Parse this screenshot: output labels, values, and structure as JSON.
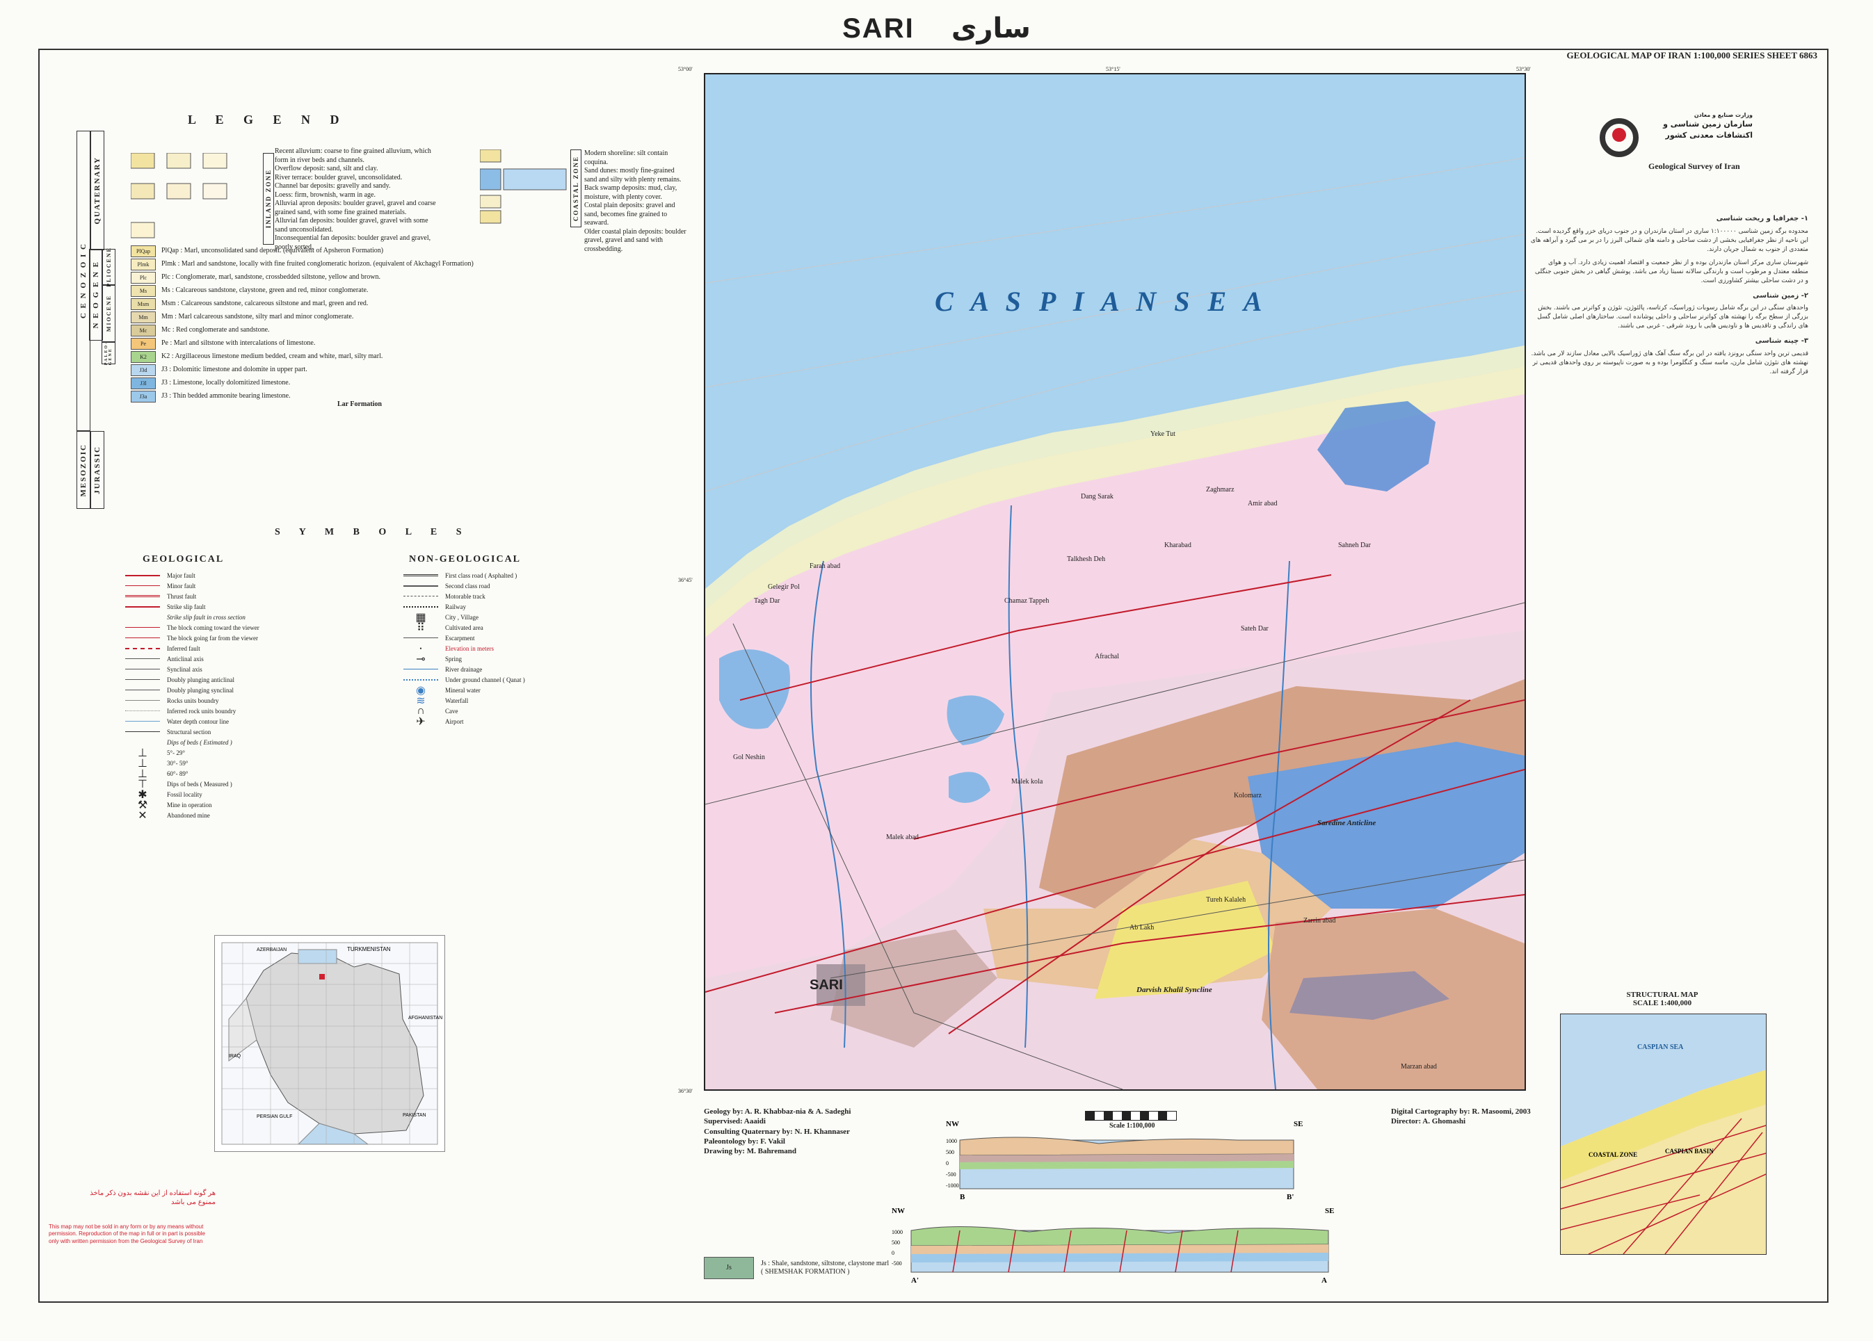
{
  "title": {
    "en": "SARI",
    "fa": "ساری"
  },
  "series_note": "GEOLOGICAL MAP OF IRAN 1:100,000 SERIES SHEET 6863",
  "legend": {
    "heading": "L E G E N D",
    "era_labels": [
      "C E N O Z O I C",
      "MESOZOIC"
    ],
    "period_labels": [
      "QUATERNARY",
      "N E O G E N E",
      "JURASSIC"
    ],
    "epoch_labels": [
      "PLIOCENE",
      "MIOCENE",
      "PALEO-GENE",
      "LATE",
      "LATE"
    ],
    "zone_labels": [
      "INLAND ZONE",
      "COASTAL ZONE"
    ],
    "quaternary_inland": [
      "Recent alluvium: coarse to fine grained alluvium, which form in river beds and channels.",
      "Overflow deposit: sand, silt and clay.",
      "River terrace: boulder gravel, unconsolidated.",
      "Channel bar deposits: gravelly and sandy.",
      "Loess: firm, brownish, warm in age.",
      "Alluvial apron deposits: boulder gravel, gravel and coarse grained sand, with some fine grained materials.",
      "Alluvial fan deposits: boulder gravel, gravel with some sand unconsolidated.",
      "Inconsequential fan deposits: boulder gravel and gravel, poorly sorted."
    ],
    "quaternary_coastal": [
      "Modern shoreline: silt contain coquina.",
      "Sand dunes: mostly fine-grained sand and silty with plenty remains.",
      "Back swamp deposits: mud, clay, moisture, with plenty cover.",
      "Costal plain deposits: gravel and sand, becomes fine grained to seaward.",
      "Older coastal plain deposits: boulder gravel, gravel and sand with crossbedding."
    ],
    "units": [
      {
        "code": "PlQap",
        "color": "#f2e3a0",
        "text": "PlQap : Marl, unconsolidated sand deposit. (equivalent of Apsheron Formation)"
      },
      {
        "code": "Plmk",
        "color": "#f6ecc0",
        "text": "Plmk : Marl and sandstone, locally with fine fruited conglomeratic horizon. (equivalent of Akchagyl Formation)"
      },
      {
        "code": "Plc",
        "color": "#f9f2d4",
        "text": "Plc : Conglomerate, marl, sandstone, crossbedded siltstone, yellow and brown."
      },
      {
        "code": "Ms",
        "color": "#efe4b0",
        "text": "Ms : Calcareous sandstone, claystone, green and red, minor conglomerate."
      },
      {
        "code": "Msm",
        "color": "#e9dea8",
        "text": "Msm : Calcareous sandstone, calcareous siltstone and marl, green and red."
      },
      {
        "code": "Mm",
        "color": "#e6d9b0",
        "text": "Mm : Marl calcareous sandstone, silty marl and minor conglomerate."
      },
      {
        "code": "Mc",
        "color": "#d9cb9a",
        "text": "Mc : Red conglomerate and sandstone."
      },
      {
        "code": "Pe",
        "color": "#f3c67a",
        "text": "Pe : Marl and siltstone with intercalations of limestone."
      },
      {
        "code": "K2",
        "color": "#a9d48e",
        "text": "K2 : Argillaceous limestone medium bedded, cream and white, marl, silty marl."
      },
      {
        "code": "J3d",
        "color": "#b8d7ef",
        "text": "J3 : Dolomitic limestone and dolomite in upper part."
      },
      {
        "code": "J3l",
        "color": "#7fb6e0",
        "text": "J3 : Limestone, locally dolomitized limestone."
      },
      {
        "code": "J3a",
        "color": "#9cc8ea",
        "text": "J3 : Thin bedded ammonite bearing limestone."
      }
    ],
    "lar_formation": "Lar Formation"
  },
  "symbols": {
    "heading": "S Y M B O L E S",
    "geological_heading": "GEOLOGICAL",
    "non_geological_heading": "NON-GEOLOGICAL",
    "geological": [
      "Major fault",
      "Minor fault",
      "Thrust fault",
      "Strike slip fault",
      "Strike slip fault in cross section",
      "The block coming toward the viewer",
      "The block going far from the viewer",
      "Inferred fault",
      "Anticlinal axis",
      "Synclinal axis",
      "Doubly plunging anticlinal",
      "Doubly plunging synclinal",
      "Rocks units boundry",
      "Inferred rock units boundry",
      "Water depth contour line",
      "Structural section",
      "Dips of beds ( Estimated )",
      "5°- 29°",
      "30°- 59°",
      "60°- 89°",
      "Dips of beds ( Measured )",
      "Fossil locality",
      "Mine in operation",
      "Abandoned mine"
    ],
    "non_geological": [
      "First class road ( Asphalted )",
      "Second class road",
      "Motorable track",
      "Railway",
      "City , Village",
      "Cultivated area",
      "Escarpment",
      "Elevation in meters",
      "Spring",
      "River drainage",
      "Under ground channel ( Qanat )",
      "Mineral water",
      "Waterfall",
      "Cave",
      "Airport"
    ]
  },
  "map": {
    "sea_label": "C A S P I A N   S E A",
    "corner_coords": [
      "53°00'",
      "53°15'",
      "53°30'",
      "36°45'",
      "36°30'"
    ],
    "places": [
      "SARI",
      "Yeke Tut",
      "Zaghmarz",
      "Farah abad",
      "Tagh Dar",
      "Gelegir Pol",
      "Amir abad",
      "Dang Sarak",
      "Kharabad",
      "Chamaz Tappeh",
      "Talkhesh Deh",
      "Sateh Dar",
      "Afrachal",
      "Sahneh Dar",
      "Gol Neshin",
      "Malek abad",
      "Malek kola",
      "Darvish Khalil Syncline",
      "Zarrin abad",
      "Ab Lakh",
      "Saredine Anticline",
      "Kolomarz",
      "Tureh Kalaleh",
      "Marzan abad"
    ],
    "scale": "Scale 1:100,000",
    "credits_left": [
      "Geology by: A. R. Khabbaz-nia & A. Sadeghi",
      "Supervised: Aaaidi",
      "Consulting Quaternary by: N. H. Khannaser",
      "Paleontology by: F. Vakil",
      "Drawing by: M. Bahremand"
    ],
    "credits_right": [
      "Digital Cartography by: R. Masoomi, 2003",
      "Director: A. Ghomashi"
    ]
  },
  "agency": {
    "fa_lines": [
      "وزارت صنایع و معادن",
      "سازمان زمین شناسی و",
      "اکتشافات معدنی کشور"
    ],
    "en_line": "Geological Survey of Iran"
  },
  "structural_map": {
    "title": "STRUCTURAL MAP",
    "scale": "SCALE 1:400,000",
    "labels": [
      "CASPIAN SEA",
      "COASTAL ZONE",
      "CASPIAN BASIN"
    ]
  },
  "sections": {
    "top": {
      "left": "NW",
      "right": "SE",
      "label_left": "B",
      "label_right": "B'"
    },
    "bottom": {
      "left": "NW",
      "right": "SE",
      "label_left": "A'",
      "label_right": "A"
    },
    "elev_ticks_top": [
      "1000",
      "500",
      "0",
      "-500",
      "-1000"
    ],
    "elev_ticks_bottom": [
      "1000",
      "500",
      "0",
      "-500"
    ]
  },
  "shemshak": {
    "code": "Js",
    "text": "Js : Shale, sandstone, siltstone, claystone marl",
    "sub": "( SHEMSHAK FORMATION )"
  },
  "index_map": {
    "labels": [
      "TURKMENISTAN",
      "AZERBAIJAN",
      "IRAQ",
      "AFGHANISTAN",
      "PAKISTAN",
      "PERSIAN GULF"
    ]
  },
  "red_note": {
    "fa": "هر گونه استفاده از این نقشه بدون ذکر ماخذ ممنوع می باشد",
    "en": "This map may not be sold in any form or by any means without permission. Reproduction of the map in full or in part is possible only with written permission from the Geological Survey of Iran"
  },
  "text_column": [
    {
      "head": "۱- جغرافیا و ریخت شناسی",
      "body": "محدوده برگه زمین شناسی ۱:۱۰۰۰۰۰ ساری در استان مازندران و در جنوب دریای خزر واقع گردیده است. این ناحیه از نظر جغرافیایی بخشی از دشت ساحلی و دامنه های شمالی البرز را در بر می گیرد و آبراهه های متعددی از جنوب به شمال جریان دارند."
    },
    {
      "head": "",
      "body": "شهرستان ساری مرکز استان مازندران بوده و از نظر جمعیت و اقتصاد اهمیت زیادی دارد. آب و هوای منطقه معتدل و مرطوب است و بارندگی سالانه نسبتا زیاد می باشد. پوشش گیاهی در بخش جنوبی جنگلی و در دشت ساحلی بیشتر کشاورزی است."
    },
    {
      "head": "۲- زمین شناسی",
      "body": "واحدهای سنگی در این برگه شامل رسوبات ژوراسیک، کرتاسه، پالئوژن، نئوژن و کواترنر می باشند. بخش بزرگی از سطح برگه را نهشته های کواترنر ساحلی و داخلی پوشانده است. ساختارهای اصلی شامل گسل های راندگی و تاقدیس ها و ناودیس هایی با روند شرقی - غربی می باشند."
    },
    {
      "head": "۳- چینه شناسی",
      "body": "قدیمی ترین واحد سنگی برونزد یافته در این برگه سنگ آهک های ژوراسیک بالایی معادل سازند لار می باشد. نهشته های نئوژن شامل مارن، ماسه سنگ و کنگلومرا بوده و به صورت ناپیوسته بر روی واحدهای قدیمی تر قرار گرفته اند."
    }
  ],
  "colors": {
    "sea": "#a9d3ee",
    "coast_strip": "#e9efcf",
    "plain": "#f6d6e6",
    "pink_deep": "#ef9ec4",
    "brown": "#d4a287",
    "tan": "#e9c49c",
    "blue_unit": "#6f9fdc",
    "yellow": "#f1e37c",
    "fault": "#c21a2b",
    "green": "#a9d48e"
  }
}
